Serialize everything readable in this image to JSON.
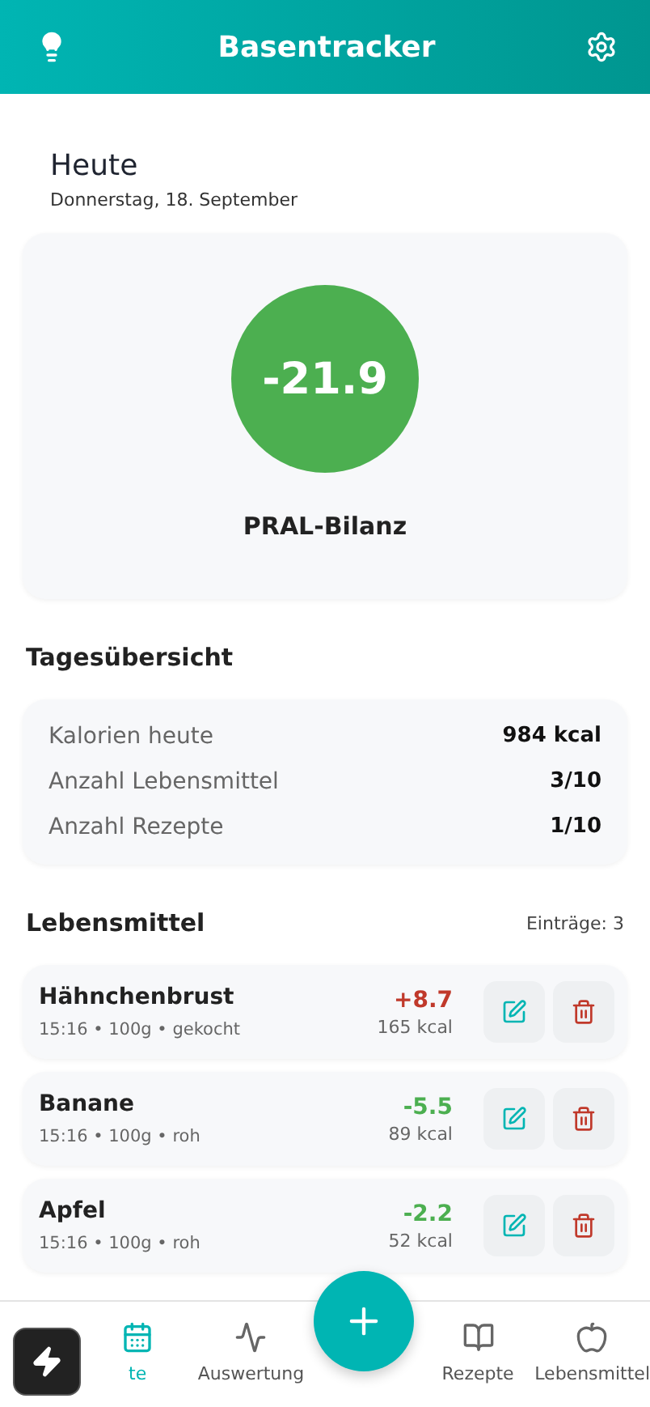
{
  "header": {
    "title": "Basentracker"
  },
  "today": {
    "title": "Heute",
    "date": "Donnerstag, 18. September"
  },
  "pral": {
    "value": "-21.9",
    "label": "PRAL-Bilanz",
    "color": "#4caf50"
  },
  "overview": {
    "title": "Tagesübersicht",
    "rows": [
      {
        "label": "Kalorien heute",
        "value": "984 kcal"
      },
      {
        "label": "Anzahl Lebensmittel",
        "value": "3/10"
      },
      {
        "label": "Anzahl Rezepte",
        "value": "1/10"
      }
    ]
  },
  "foods": {
    "title": "Lebensmittel",
    "count": "Einträge: 3",
    "items": [
      {
        "name": "Hähnchenbrust",
        "meta": "15:16 • 100g • gekocht",
        "pral": "+8.7",
        "color": "#c0392b",
        "kcal": "165 kcal"
      },
      {
        "name": "Banane",
        "meta": "15:16 • 100g • roh",
        "pral": "-5.5",
        "color": "#4caf50",
        "kcal": "89 kcal"
      },
      {
        "name": "Apfel",
        "meta": "15:16 • 100g • roh",
        "pral": "-2.2",
        "color": "#4caf50",
        "kcal": "52 kcal"
      }
    ]
  },
  "nav": [
    {
      "kind": "calendar",
      "label": "te",
      "selected": true
    },
    {
      "kind": "chart",
      "label": "Auswertung",
      "selected": false
    },
    {
      "kind": "add"
    },
    {
      "kind": "book",
      "label": "Rezepte",
      "selected": false
    },
    {
      "kind": "apple",
      "label": "Lebensmittel",
      "selected": false
    }
  ]
}
